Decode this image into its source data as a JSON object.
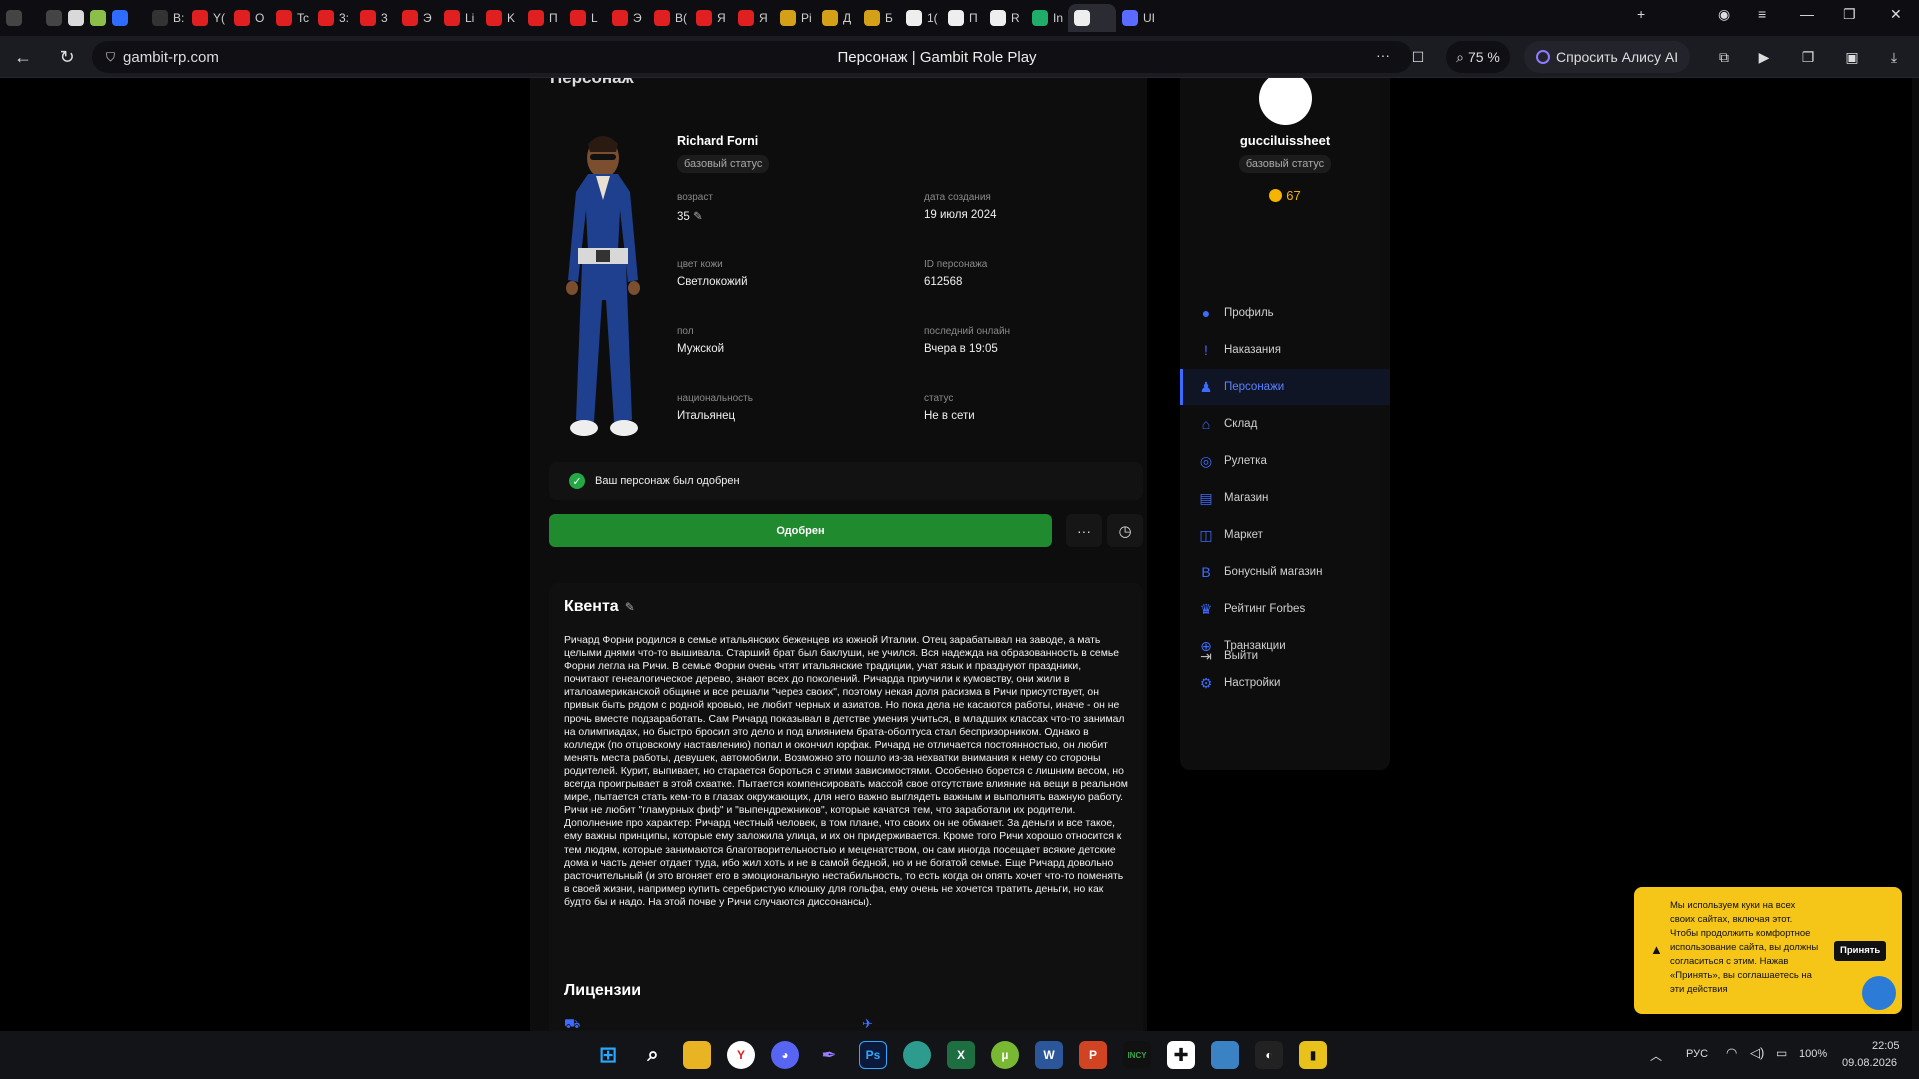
{
  "tabs": [
    {
      "label": "",
      "color": "#444"
    },
    {
      "label": "",
      "color": "#444"
    },
    {
      "label": "",
      "color": "#d9d9d9"
    },
    {
      "label": "",
      "color": "#8bbf4a"
    },
    {
      "label": "",
      "color": "#2f6bff"
    },
    {
      "label": "B:",
      "color": "#333"
    },
    {
      "label": "Y(",
      "color": "#e02020"
    },
    {
      "label": "O",
      "color": "#e02020"
    },
    {
      "label": "Tc",
      "color": "#e02020"
    },
    {
      "label": "3:",
      "color": "#e02020"
    },
    {
      "label": "3",
      "color": "#e02020"
    },
    {
      "label": "Э",
      "color": "#e02020"
    },
    {
      "label": "Li",
      "color": "#e02020"
    },
    {
      "label": "K",
      "color": "#e02020"
    },
    {
      "label": "П",
      "color": "#e02020"
    },
    {
      "label": "L",
      "color": "#e02020"
    },
    {
      "label": "Э",
      "color": "#e02020"
    },
    {
      "label": "B(",
      "color": "#e02020"
    },
    {
      "label": "Я",
      "color": "#e02020"
    },
    {
      "label": "Я",
      "color": "#e02020"
    },
    {
      "label": "Pi",
      "color": "#d4a017"
    },
    {
      "label": "Д",
      "color": "#d4a017"
    },
    {
      "label": "Б",
      "color": "#d4a017"
    },
    {
      "label": "1(",
      "color": "#eee"
    },
    {
      "label": "П",
      "color": "#eee"
    },
    {
      "label": "R",
      "color": "#eee"
    },
    {
      "label": "In",
      "color": "#1fae6a"
    },
    {
      "label": "",
      "color": "#eee"
    },
    {
      "label": "UI",
      "color": "#5b6bff"
    }
  ],
  "address": {
    "url": "gambit-rp.com",
    "page_title": "Персонаж | Gambit Role Play",
    "zoom": "75 %",
    "alisa_label": "Спросить Алису AI"
  },
  "section_title_partial": "Персонаж",
  "character": {
    "name": "Richard Forni",
    "status_badge": "базовый статус",
    "fields": [
      {
        "label": "возраст",
        "value": "35",
        "editable": true
      },
      {
        "label": "дата создания",
        "value": "19 июля 2024"
      },
      {
        "label": "цвет кожи",
        "value": "Светлокожий"
      },
      {
        "label": "ID персонажа",
        "value": "612568"
      },
      {
        "label": "пол",
        "value": "Мужской"
      },
      {
        "label": "последний онлайн",
        "value": "Вчера в 19:05"
      },
      {
        "label": "национальность",
        "value": "Итальянец"
      },
      {
        "label": "статус",
        "value": "Не в сети"
      }
    ],
    "approval_note": "Ваш персонаж был одобрен",
    "approved_button": "Одобрен",
    "more_button": "···"
  },
  "quenta": {
    "title": "Квента",
    "text": "Ричард Форни родился в семье итальянских беженцев из южной Италии. Отец зарабатывал на заводе, а мать целыми днями что-то вышивала. Старший брат был баклуши, не учился. Вся надежда на образованность в семье Форни легла на Ричи. В семье Форни очень чтят итальянские традиции, учат язык и празднуют праздники, почитают генеалогическое дерево, знают всех до поколений. Ричарда приучили к кумовству, они жили в италоамериканской общине и все решали \"через своих\", поэтому некая доля расизма в Ричи присутствует, он привык быть рядом с родной кровью, не любит черных и азиатов. Но пока дела не касаются работы, иначе - он не прочь вместе подзаработать. Сам Ричард показывал в детстве умения учиться, в младших классах что-то занимал на олимпиадах, но быстро бросил это дело и под влиянием брата-оболтуса стал беспризорником. Однако в колледж (по отцовскому наставлению) попал и окончил юрфак. Ричард не отличается постоянностью, он любит менять места работы, девушек, автомобили. Возможно это пошло из-за нехватки внимания к нему со стороны родителей. Курит, выпивает, но старается бороться с этими зависимостями. Особенно борется с лишним весом, но всегда проигрывает в этой схватке. Пытается компенсировать массой свое отсутствие влияние на вещи в реальном мире, пытается стать кем-то в глазах окружающих, для него важно выглядеть важным и выполнять важную работу. Ричи не любит \"гламурных фиф\" и \"выпендрежников\", которые качатся тем, что заработали их родители.",
    "text2": "Дополнение про характер: Ричард честный человек, в том плане, что своих он не обманет. За деньги и все такое, ему важны принципы, которые ему заложила улица, и их он придерживается. Кроме того Ричи хорошо относится к тем людям, которые занимаются благотворительностью и меценатством, он сам иногда посещает всякие детские дома и часть денег отдает туда, ибо жил хоть и не в самой бедной, но и не богатой семье. Еще Ричард довольно расточительный (и это вгоняет его в эмоциональную нестабильность, то есть когда он опять хочет что-то поменять в своей жизни, например купить серебристую клюшку для гольфа, ему очень не хочется тратить деньги, но как будто бы и надо. На этой почве у Ричи случаются диссонансы)."
  },
  "licenses_title": "Лицензии",
  "user": {
    "username": "gucciluissheet",
    "status_badge": "базовый статус",
    "coins": "67"
  },
  "menu": [
    {
      "label": "Профиль",
      "icon": "user-icon",
      "glyph": "●",
      "active": false
    },
    {
      "label": "Наказания",
      "icon": "alert-icon",
      "glyph": "!",
      "active": false
    },
    {
      "label": "Персонажи",
      "icon": "person-icon",
      "glyph": "♟",
      "active": true
    },
    {
      "label": "Склад",
      "icon": "warehouse-icon",
      "glyph": "⌂",
      "active": false
    },
    {
      "label": "Рулетка",
      "icon": "roulette-icon",
      "glyph": "◎",
      "active": false
    },
    {
      "label": "Магазин",
      "icon": "shop-icon",
      "glyph": "▤",
      "active": false
    },
    {
      "label": "Маркет",
      "icon": "market-icon",
      "glyph": "◫",
      "active": false
    },
    {
      "label": "Бонусный магазин",
      "icon": "bonus-icon",
      "glyph": "B",
      "active": false
    },
    {
      "label": "Рейтинг Forbes",
      "icon": "trophy-icon",
      "glyph": "♛",
      "active": false
    },
    {
      "label": "Транзакции",
      "icon": "transactions-icon",
      "glyph": "⊕",
      "active": false
    },
    {
      "label": "Настройки",
      "icon": "gear-icon",
      "glyph": "⚙",
      "active": false
    }
  ],
  "logout_label": "Выйти",
  "cookie": {
    "text": "Мы используем куки на всех своих сайтах, включая этот. Чтобы продолжить комфортное использование сайта, вы должны согласиться с этим. Нажав «Принять», вы соглашаетесь на эти действия",
    "accept": "Принять"
  },
  "taskbar": {
    "lang": "РУС",
    "battery": "100%",
    "time": "22:05",
    "date": "09.08.2026"
  },
  "colors": {
    "accent": "#3d6bff",
    "approve": "#1f8a2e",
    "cookie": "#f5c518"
  }
}
